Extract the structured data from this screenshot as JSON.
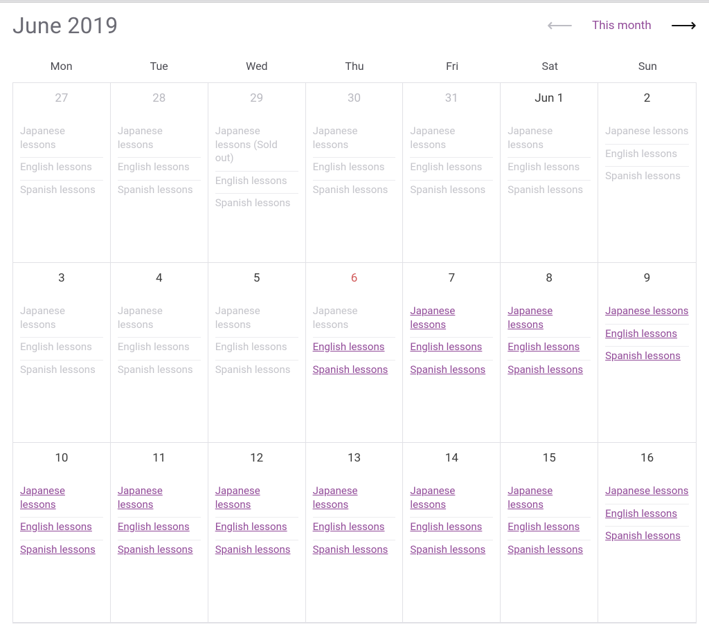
{
  "header": {
    "title": "June 2019",
    "this_month_label": "This month"
  },
  "dow": [
    "Mon",
    "Tue",
    "Wed",
    "Thu",
    "Fri",
    "Sat",
    "Sun"
  ],
  "events_past_default": [
    "Japanese lessons",
    "English lessons",
    "Spanish lessons"
  ],
  "events_avail_default": [
    "Japanese lessons",
    "English lessons",
    "Spanish lessons"
  ],
  "weeks": [
    {
      "days": [
        {
          "label": "27",
          "muted": true,
          "today": false,
          "events": [
            {
              "t": "Japanese lessons",
              "s": "past"
            },
            {
              "t": "English lessons",
              "s": "past"
            },
            {
              "t": "Spanish lessons",
              "s": "past"
            }
          ]
        },
        {
          "label": "28",
          "muted": true,
          "today": false,
          "events": [
            {
              "t": "Japanese lessons",
              "s": "past"
            },
            {
              "t": "English lessons",
              "s": "past"
            },
            {
              "t": "Spanish lessons",
              "s": "past"
            }
          ]
        },
        {
          "label": "29",
          "muted": true,
          "today": false,
          "events": [
            {
              "t": "Japanese lessons (Sold out)",
              "s": "past"
            },
            {
              "t": "English lessons",
              "s": "past"
            },
            {
              "t": "Spanish lessons",
              "s": "past"
            }
          ]
        },
        {
          "label": "30",
          "muted": true,
          "today": false,
          "events": [
            {
              "t": "Japanese lessons",
              "s": "past"
            },
            {
              "t": "English lessons",
              "s": "past"
            },
            {
              "t": "Spanish lessons",
              "s": "past"
            }
          ]
        },
        {
          "label": "31",
          "muted": true,
          "today": false,
          "events": [
            {
              "t": "Japanese lessons",
              "s": "past"
            },
            {
              "t": "English lessons",
              "s": "past"
            },
            {
              "t": "Spanish lessons",
              "s": "past"
            }
          ]
        },
        {
          "label": "Jun 1",
          "muted": false,
          "today": false,
          "events": [
            {
              "t": "Japanese lessons",
              "s": "past"
            },
            {
              "t": "English lessons",
              "s": "past"
            },
            {
              "t": "Spanish lessons",
              "s": "past"
            }
          ]
        },
        {
          "label": "2",
          "muted": false,
          "today": false,
          "events": [
            {
              "t": "Japanese lessons",
              "s": "past"
            },
            {
              "t": "English lessons",
              "s": "past"
            },
            {
              "t": "Spanish lessons",
              "s": "past"
            }
          ]
        }
      ]
    },
    {
      "days": [
        {
          "label": "3",
          "muted": false,
          "today": false,
          "events": [
            {
              "t": "Japanese lessons",
              "s": "past"
            },
            {
              "t": "English lessons",
              "s": "past"
            },
            {
              "t": "Spanish lessons",
              "s": "past"
            }
          ]
        },
        {
          "label": "4",
          "muted": false,
          "today": false,
          "events": [
            {
              "t": "Japanese lessons",
              "s": "past"
            },
            {
              "t": "English lessons",
              "s": "past"
            },
            {
              "t": "Spanish lessons",
              "s": "past"
            }
          ]
        },
        {
          "label": "5",
          "muted": false,
          "today": false,
          "events": [
            {
              "t": "Japanese lessons",
              "s": "past"
            },
            {
              "t": "English lessons",
              "s": "past"
            },
            {
              "t": "Spanish lessons",
              "s": "past"
            }
          ]
        },
        {
          "label": "6",
          "muted": false,
          "today": true,
          "events": [
            {
              "t": "Japanese lessons",
              "s": "past"
            },
            {
              "t": "English lessons",
              "s": "avail"
            },
            {
              "t": "Spanish lessons",
              "s": "avail"
            }
          ]
        },
        {
          "label": "7",
          "muted": false,
          "today": false,
          "events": [
            {
              "t": "Japanese lessons",
              "s": "avail"
            },
            {
              "t": "English lessons",
              "s": "avail"
            },
            {
              "t": "Spanish lessons",
              "s": "avail"
            }
          ]
        },
        {
          "label": "8",
          "muted": false,
          "today": false,
          "events": [
            {
              "t": "Japanese lessons",
              "s": "avail"
            },
            {
              "t": "English lessons",
              "s": "avail"
            },
            {
              "t": "Spanish lessons",
              "s": "avail"
            }
          ]
        },
        {
          "label": "9",
          "muted": false,
          "today": false,
          "events": [
            {
              "t": "Japanese lessons",
              "s": "avail"
            },
            {
              "t": "English lessons",
              "s": "avail"
            },
            {
              "t": "Spanish lessons",
              "s": "avail"
            }
          ]
        }
      ]
    },
    {
      "days": [
        {
          "label": "10",
          "muted": false,
          "today": false,
          "events": [
            {
              "t": "Japanese lessons",
              "s": "avail"
            },
            {
              "t": "English lessons",
              "s": "avail"
            },
            {
              "t": "Spanish lessons",
              "s": "avail"
            }
          ]
        },
        {
          "label": "11",
          "muted": false,
          "today": false,
          "events": [
            {
              "t": "Japanese lessons",
              "s": "avail"
            },
            {
              "t": "English lessons",
              "s": "avail"
            },
            {
              "t": "Spanish lessons",
              "s": "avail"
            }
          ]
        },
        {
          "label": "12",
          "muted": false,
          "today": false,
          "events": [
            {
              "t": "Japanese lessons",
              "s": "avail"
            },
            {
              "t": "English lessons",
              "s": "avail"
            },
            {
              "t": "Spanish lessons",
              "s": "avail"
            }
          ]
        },
        {
          "label": "13",
          "muted": false,
          "today": false,
          "events": [
            {
              "t": "Japanese lessons",
              "s": "avail"
            },
            {
              "t": "English lessons",
              "s": "avail"
            },
            {
              "t": "Spanish lessons",
              "s": "avail"
            }
          ]
        },
        {
          "label": "14",
          "muted": false,
          "today": false,
          "events": [
            {
              "t": "Japanese lessons",
              "s": "avail"
            },
            {
              "t": "English lessons",
              "s": "avail"
            },
            {
              "t": "Spanish lessons",
              "s": "avail"
            }
          ]
        },
        {
          "label": "15",
          "muted": false,
          "today": false,
          "events": [
            {
              "t": "Japanese lessons",
              "s": "avail"
            },
            {
              "t": "English lessons",
              "s": "avail"
            },
            {
              "t": "Spanish lessons",
              "s": "avail"
            }
          ]
        },
        {
          "label": "16",
          "muted": false,
          "today": false,
          "events": [
            {
              "t": "Japanese lessons",
              "s": "avail"
            },
            {
              "t": "English lessons",
              "s": "avail"
            },
            {
              "t": "Spanish lessons",
              "s": "avail"
            }
          ]
        }
      ]
    }
  ]
}
